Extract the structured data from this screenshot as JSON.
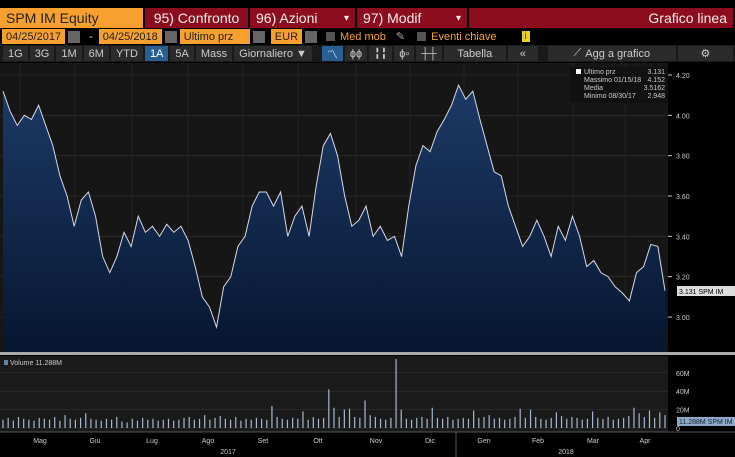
{
  "header": {
    "ticker": "SPM IM Equity",
    "menu1": "95) Confronto",
    "menu2": "96) Azioni",
    "menu3": "97) Modif",
    "chart_type": "Grafico linea"
  },
  "controls": {
    "start_date": "04/25/2017",
    "dash": "-",
    "end_date": "04/25/2018",
    "field": "Ultimo prz",
    "currency": "EUR",
    "moving_avg": "Med mob",
    "key_events": "Eventi chiave",
    "info": "i"
  },
  "toolbar": {
    "ranges": [
      "1G",
      "3G",
      "1M",
      "6M",
      "YTD",
      "1A",
      "5A",
      "Mass"
    ],
    "selected": "1A",
    "period": "Giornaliero ▼",
    "table": "Tabella",
    "collapse": "«",
    "add": "Agg a grafico",
    "settings": "⚙"
  },
  "legend": {
    "last_label": "Ultimo prz",
    "last_value": "3.131",
    "max_label": "Massimo 01/15/18",
    "max_value": "4.152",
    "avg_label": "Media",
    "avg_value": "3.5162",
    "min_label": "Minimo 08/30/17",
    "min_value": "2.948"
  },
  "price_tag": "3.131 SPM IM",
  "volume_label": "Volume 11.288M",
  "volume_tag": "11.288M SPM IM",
  "chart_data": {
    "type": "line",
    "price": {
      "yticks": [
        "4.20",
        "4.00",
        "3.80",
        "3.60",
        "3.40",
        "3.20",
        "3.00"
      ],
      "ylim": [
        2.85,
        4.26
      ],
      "values": [
        4.12,
        4.02,
        3.95,
        4.0,
        3.98,
        4.05,
        3.95,
        3.85,
        3.7,
        3.6,
        3.45,
        3.58,
        3.62,
        3.5,
        3.3,
        3.22,
        3.3,
        3.42,
        3.35,
        3.5,
        3.42,
        3.45,
        3.4,
        3.46,
        3.42,
        3.45,
        3.38,
        3.25,
        3.1,
        3.05,
        2.95,
        3.15,
        3.2,
        3.35,
        3.4,
        3.55,
        3.62,
        3.62,
        3.55,
        3.62,
        3.4,
        3.5,
        3.55,
        3.4,
        3.65,
        3.85,
        3.91,
        3.8,
        3.6,
        3.45,
        3.48,
        3.55,
        3.4,
        3.45,
        3.38,
        3.4,
        3.3,
        3.55,
        3.75,
        3.85,
        3.82,
        3.92,
        3.98,
        4.05,
        4.15,
        4.08,
        4.12,
        3.98,
        3.85,
        3.72,
        3.7,
        3.55,
        3.45,
        3.35,
        3.4,
        3.48,
        3.4,
        3.3,
        3.45,
        3.38,
        3.5,
        3.4,
        3.25,
        3.28,
        3.22,
        3.2,
        3.15,
        3.12,
        3.08,
        3.22,
        3.25,
        3.36,
        3.35,
        3.131
      ]
    },
    "volume": {
      "yticks": [
        "60M",
        "40M",
        "20M",
        "0"
      ],
      "ylim": [
        0,
        80
      ],
      "values": [
        9,
        11,
        8,
        12,
        10,
        9,
        8,
        11,
        10,
        9,
        12,
        8,
        14,
        10,
        9,
        11,
        16,
        10,
        9,
        8,
        10,
        9,
        12,
        7,
        6,
        10,
        8,
        11,
        9,
        10,
        8,
        9,
        10,
        8,
        9,
        11,
        12,
        9,
        10,
        14,
        9,
        11,
        13,
        10,
        9,
        12,
        8,
        10,
        9,
        11,
        10,
        9,
        24,
        12,
        10,
        9,
        11,
        10,
        18,
        9,
        12,
        10,
        11,
        42,
        22,
        12,
        20,
        21,
        12,
        11,
        30,
        14,
        12,
        10,
        9,
        11,
        75,
        20,
        10,
        9,
        11,
        12,
        10,
        22,
        11,
        10,
        12,
        9,
        10,
        11,
        10,
        19,
        11,
        12,
        14,
        10,
        11,
        9,
        10,
        12,
        21,
        11,
        20,
        12,
        10,
        9,
        11,
        17,
        13,
        10,
        12,
        11,
        9,
        10,
        18,
        11,
        10,
        12,
        9,
        10,
        11,
        13,
        22,
        16,
        12,
        19,
        11,
        17,
        14
      ]
    },
    "xticks": [
      "Mag",
      "Giu",
      "Lug",
      "Ago",
      "Set",
      "Ott",
      "Nov",
      "Dic",
      "Gen",
      "Feb",
      "Mar",
      "Apr"
    ],
    "years": [
      "2017",
      "2018"
    ]
  }
}
